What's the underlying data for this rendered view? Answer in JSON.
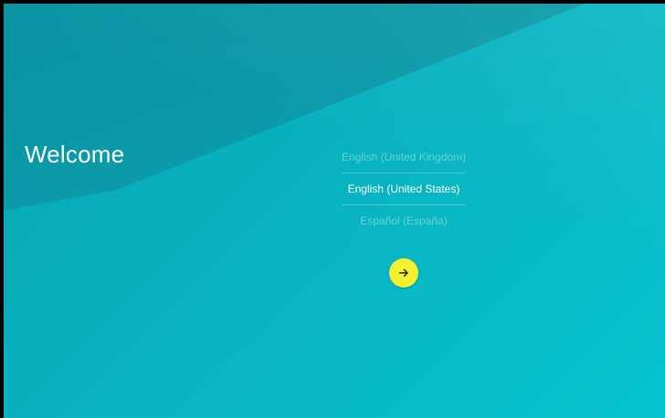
{
  "welcome": {
    "title": "Welcome"
  },
  "languages": {
    "items": [
      {
        "label": "English (United Kingdom)",
        "selected": false
      },
      {
        "label": "English (United States)",
        "selected": true
      },
      {
        "label": "Español (España)",
        "selected": false
      }
    ]
  },
  "next_button": {
    "icon": "arrow-right-icon",
    "color": "#f2f231"
  },
  "colors": {
    "background": "#08b2c0",
    "accent": "#f2f231"
  }
}
